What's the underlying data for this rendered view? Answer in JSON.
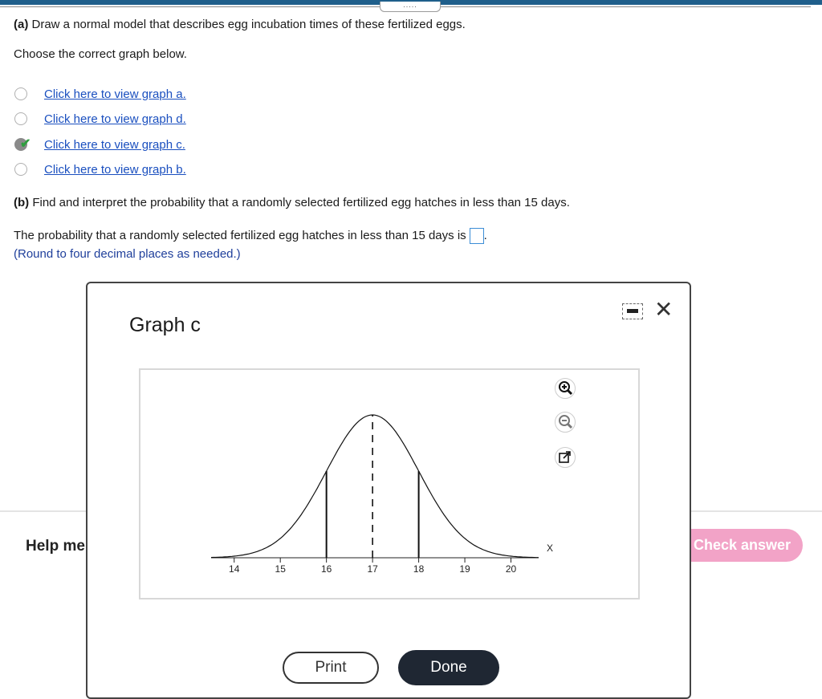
{
  "header": {
    "handle_dots": "....."
  },
  "part_a": {
    "label": "(a)",
    "question": "Draw a normal model that describes egg incubation times of these fertilized eggs.",
    "instruction": "Choose the correct graph below.",
    "options": [
      {
        "label": "Click here to view graph a.",
        "selected": false
      },
      {
        "label": "Click here to view graph d.",
        "selected": false
      },
      {
        "label": "Click here to view graph c.",
        "selected": true
      },
      {
        "label": "Click here to view graph b.",
        "selected": false
      }
    ]
  },
  "part_b": {
    "label": "(b)",
    "question": "Find and interpret the probability that a randomly selected fertilized egg hatches in less than 15 days.",
    "statement": "The probability that a randomly selected fertilized egg hatches in less than 15 days is",
    "answer_value": "",
    "statement_end": ".",
    "hint": "(Round to four decimal places as needed.)"
  },
  "footer": {
    "help_label": "Help me",
    "check_answer_label": "Check answer"
  },
  "modal": {
    "title": "Graph c",
    "print_label": "Print",
    "done_label": "Done",
    "icons": [
      "zoom-in-icon",
      "zoom-out-icon",
      "external-link-icon",
      "minimize-icon",
      "close-icon"
    ]
  },
  "chart_data": {
    "type": "line",
    "title": "",
    "xlabel": "X",
    "ylabel": "",
    "xlim": [
      13.5,
      20.6
    ],
    "x_ticks": [
      14,
      15,
      16,
      17,
      18,
      19,
      20
    ],
    "tick_labels": [
      "14",
      "15",
      "16",
      "17",
      "18",
      "19",
      "20"
    ],
    "mean": 17,
    "sd": 1,
    "series": [
      {
        "values": "normal density curve centered at 17"
      }
    ],
    "solid_lines_at": [
      16,
      18
    ],
    "dashed_line_at": 17,
    "grid": false
  }
}
